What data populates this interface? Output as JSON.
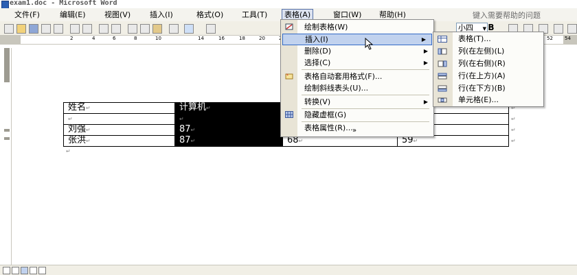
{
  "window": {
    "title": "exam1.doc - Microsoft Word"
  },
  "menubar": {
    "items": [
      "文件(F)",
      "编辑(E)",
      "视图(V)",
      "插入(I)",
      "格式(O)",
      "工具(T)",
      "表格(A)",
      "窗口(W)",
      "帮助(H)"
    ],
    "active": "表格(A)",
    "help_placeholder": "键入需要帮助的问题"
  },
  "toolbar": {
    "font_size": "小四",
    "bold_label": "B"
  },
  "ruler": {
    "ticks": [
      "2",
      "4",
      "6",
      "8",
      "10",
      "14",
      "16",
      "18",
      "20",
      "22",
      "52",
      "54"
    ]
  },
  "table_menu": {
    "items": [
      {
        "label": "绘制表格(W)",
        "icon": "pencil-icon",
        "submenu": false
      },
      {
        "label": "插入(I)",
        "icon": "",
        "submenu": true,
        "highlighted": true
      },
      {
        "label": "删除(D)",
        "icon": "",
        "submenu": true
      },
      {
        "label": "选择(C)",
        "icon": "",
        "submenu": true
      },
      {
        "label": "表格自动套用格式(F)...",
        "icon": "autoformat-icon",
        "submenu": false
      },
      {
        "label": "绘制斜线表头(U)...",
        "icon": "",
        "submenu": false
      },
      {
        "label": "转换(V)",
        "icon": "",
        "submenu": true
      },
      {
        "label": "隐藏虚框(G)",
        "icon": "grid-icon",
        "submenu": false
      },
      {
        "label": "表格属性(R)...",
        "icon": "",
        "submenu": false
      }
    ],
    "expand": "»"
  },
  "insert_submenu": {
    "items": [
      {
        "label": "表格(T)...",
        "icon": "table-icon"
      },
      {
        "label": "列(在左侧)(L)",
        "icon": "column-left-icon"
      },
      {
        "label": "列(在右侧)(R)",
        "icon": "column-right-icon"
      },
      {
        "label": "行(在上方)(A)",
        "icon": "row-above-icon"
      },
      {
        "label": "行(在下方)(B)",
        "icon": "row-below-icon"
      },
      {
        "label": "单元格(E)...",
        "icon": "cell-icon"
      }
    ]
  },
  "document_table": {
    "rows": [
      [
        "姓名",
        "计算机",
        "",
        ""
      ],
      [
        "",
        "",
        "",
        ""
      ],
      [
        "刘强",
        "87",
        "",
        ""
      ],
      [
        "张洪",
        "87",
        "68",
        "59"
      ]
    ],
    "selected_column": 1
  }
}
